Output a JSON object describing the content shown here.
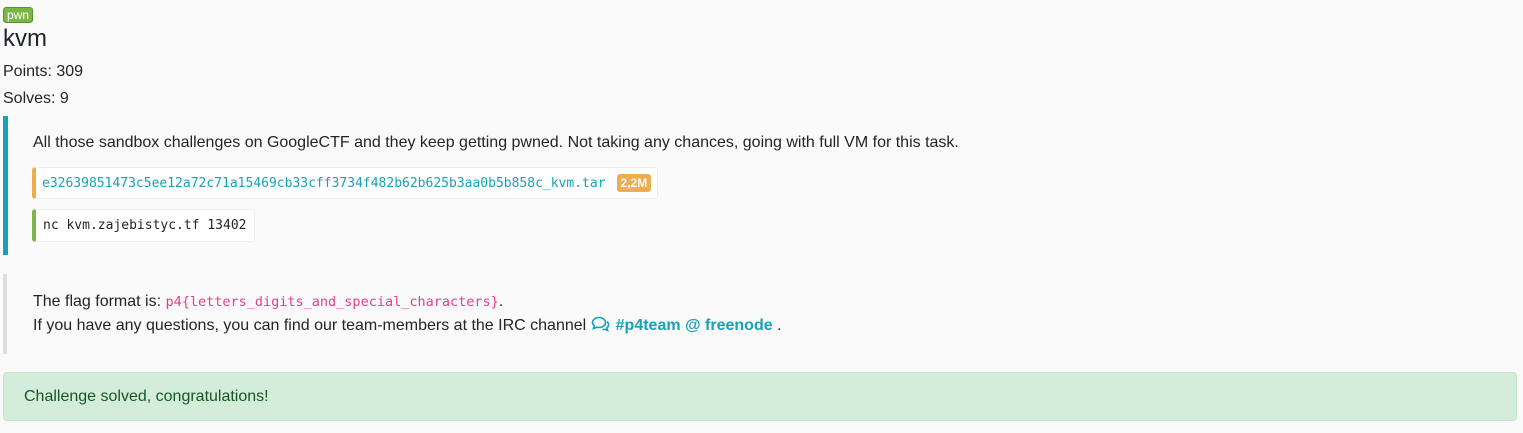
{
  "challenge": {
    "category": "pwn",
    "title": "kvm",
    "points": "Points: 309",
    "solves": "Solves: 9"
  },
  "description": {
    "text": "All those sandbox challenges on GoogleCTF and they keep getting pwned. Not taking any chances, going with full VM for this task.",
    "file": {
      "name": "e32639851473c5ee12a72c71a15469cb33cff3734f482b62b625b3aa0b5b858c_kvm.tar",
      "size": "2,2M"
    },
    "connection": "nc kvm.zajebistyc.tf 13402"
  },
  "flag_info": {
    "prefix": "The flag format is: ",
    "format": "p4{letters_digits_and_special_characters}",
    "suffix": ".",
    "question_text": "If you have any questions, you can find our team-members at the IRC channel ",
    "irc_link": "#p4team @ freenode",
    "irc_suffix": " .",
    "icon": "comments-icon"
  },
  "status": {
    "message": "Challenge solved, congratulations!"
  },
  "colors": {
    "accent": "#17a2b8",
    "category_badge": "#7ab648",
    "size_badge": "#f0ad4e",
    "flag_code": "#e83e8c",
    "success_bg": "#d4edda",
    "success_text": "#155724"
  }
}
